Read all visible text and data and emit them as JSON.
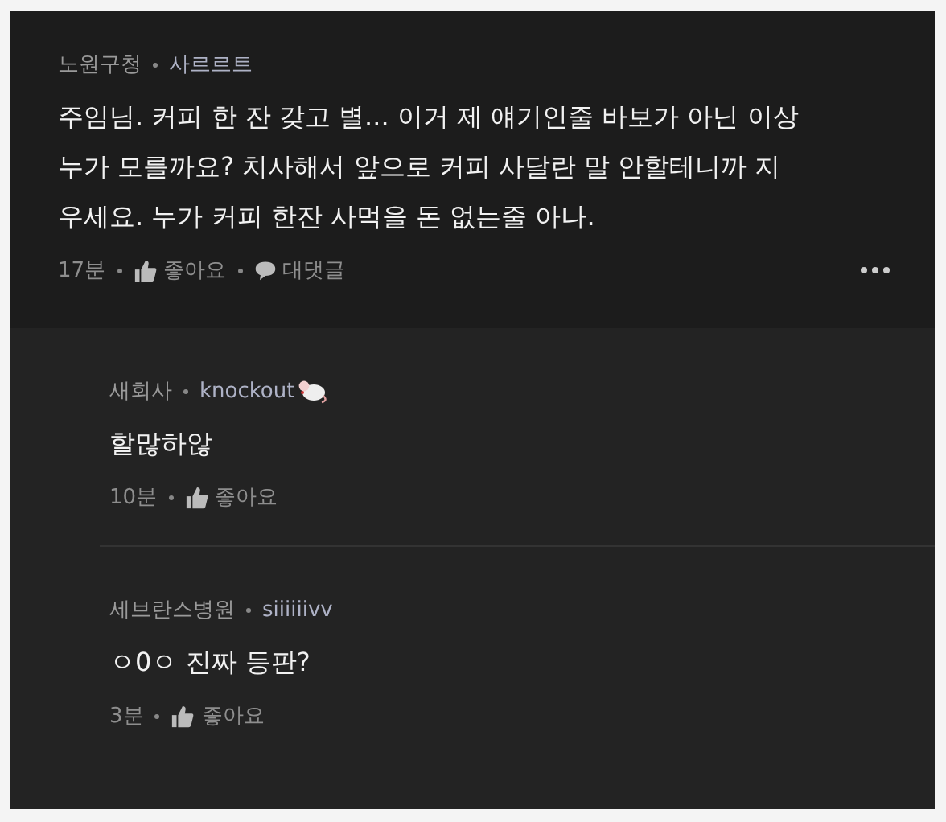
{
  "comments": [
    {
      "kind": "top",
      "company": "노원구청",
      "nickname": "사르르트",
      "has_badge": false,
      "body": "주임님. 커피 한 잔 갖고 별... 이거 제 얘기인줄 바보가 아닌 이상 누가 모를까요? 치사해서 앞으로 커피 사달란 말 안할테니까 지우세요. 누가 커피 한잔 사먹을 돈 없는줄 아나.",
      "time": "17분",
      "like_label": "좋아요",
      "reply_label": "대댓글"
    },
    {
      "kind": "reply",
      "company": "새회사",
      "nickname": "knockout",
      "has_badge": true,
      "body": "할많하않",
      "time": "10분",
      "like_label": "좋아요"
    },
    {
      "kind": "reply",
      "company": "세브란스병원",
      "nickname": "siiiiiivv",
      "has_badge": false,
      "body": "ㅇ0ㅇ 진짜 등판?",
      "time": "3분",
      "like_label": "좋아요"
    }
  ]
}
